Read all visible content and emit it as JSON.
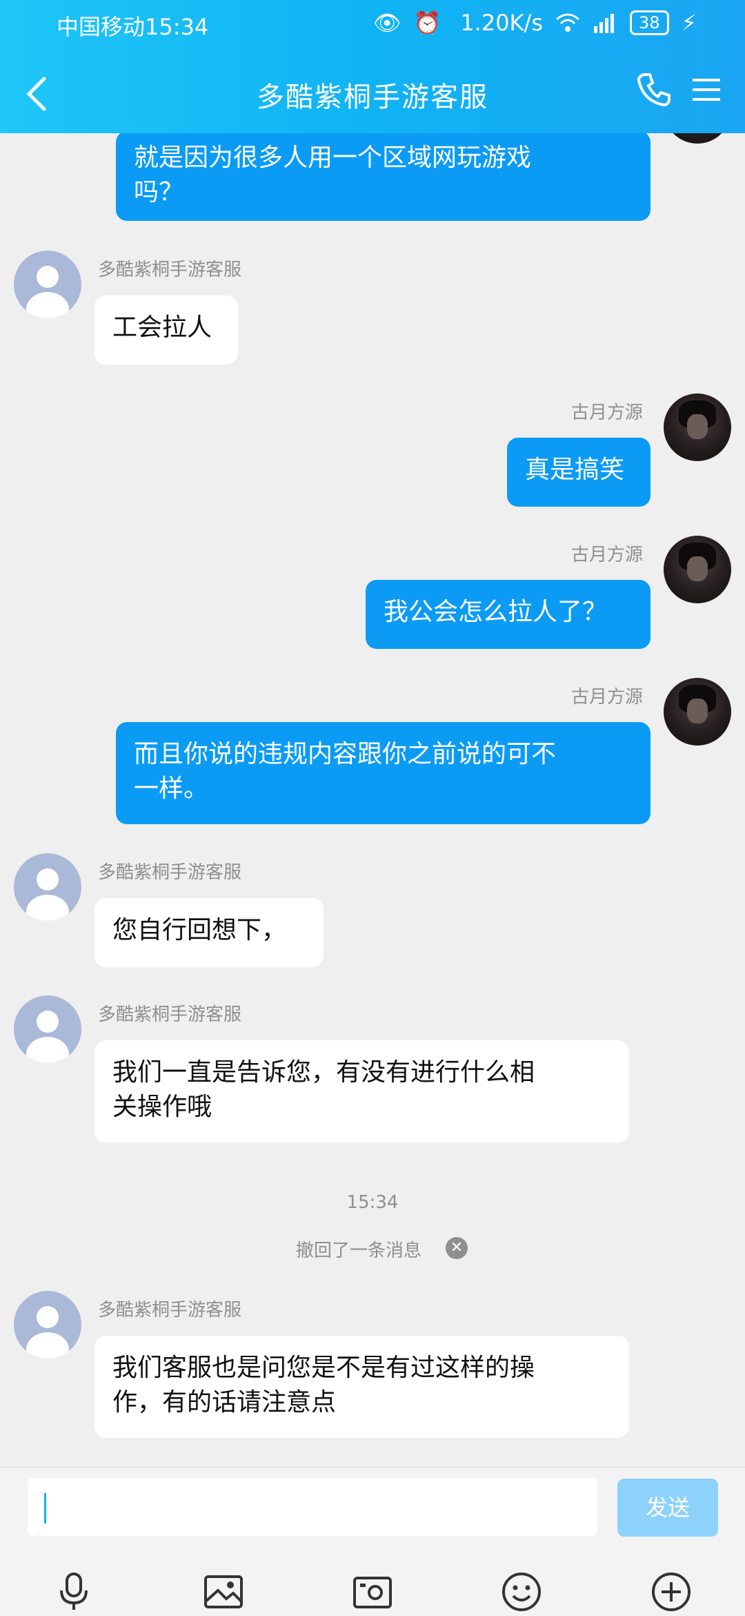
{
  "status": {
    "carrier_time": "中国移动15:34",
    "speed": "1.20K/s",
    "battery": "38"
  },
  "header": {
    "title": "多酷紫桐手游客服"
  },
  "messages": [
    {
      "text": "就是因为很多人用一个区域网玩游戏\n吗？"
    },
    {
      "name": "多酷紫桐手游客服",
      "text": "工会拉人"
    },
    {
      "name": "古月方源",
      "text": "真是搞笑"
    },
    {
      "name": "古月方源",
      "text": "我公会怎么拉人了？"
    },
    {
      "name": "古月方源",
      "text": "而且你说的违规内容跟你之前说的可不\n一样。"
    },
    {
      "name": "多酷紫桐手游客服",
      "text": "您自行回想下，"
    },
    {
      "name": "多酷紫桐手游客服",
      "text": "我们一直是告诉您，有没有进行什么相\n关操作哦"
    },
    {
      "name": "多酷紫桐手游客服",
      "text": "我们客服也是问您是不是有过这样的操\n作，有的话请注意点"
    }
  ],
  "timestamp": "15:34",
  "recall_notice": "撤回了一条消息",
  "input": {
    "send_label": "发送"
  }
}
